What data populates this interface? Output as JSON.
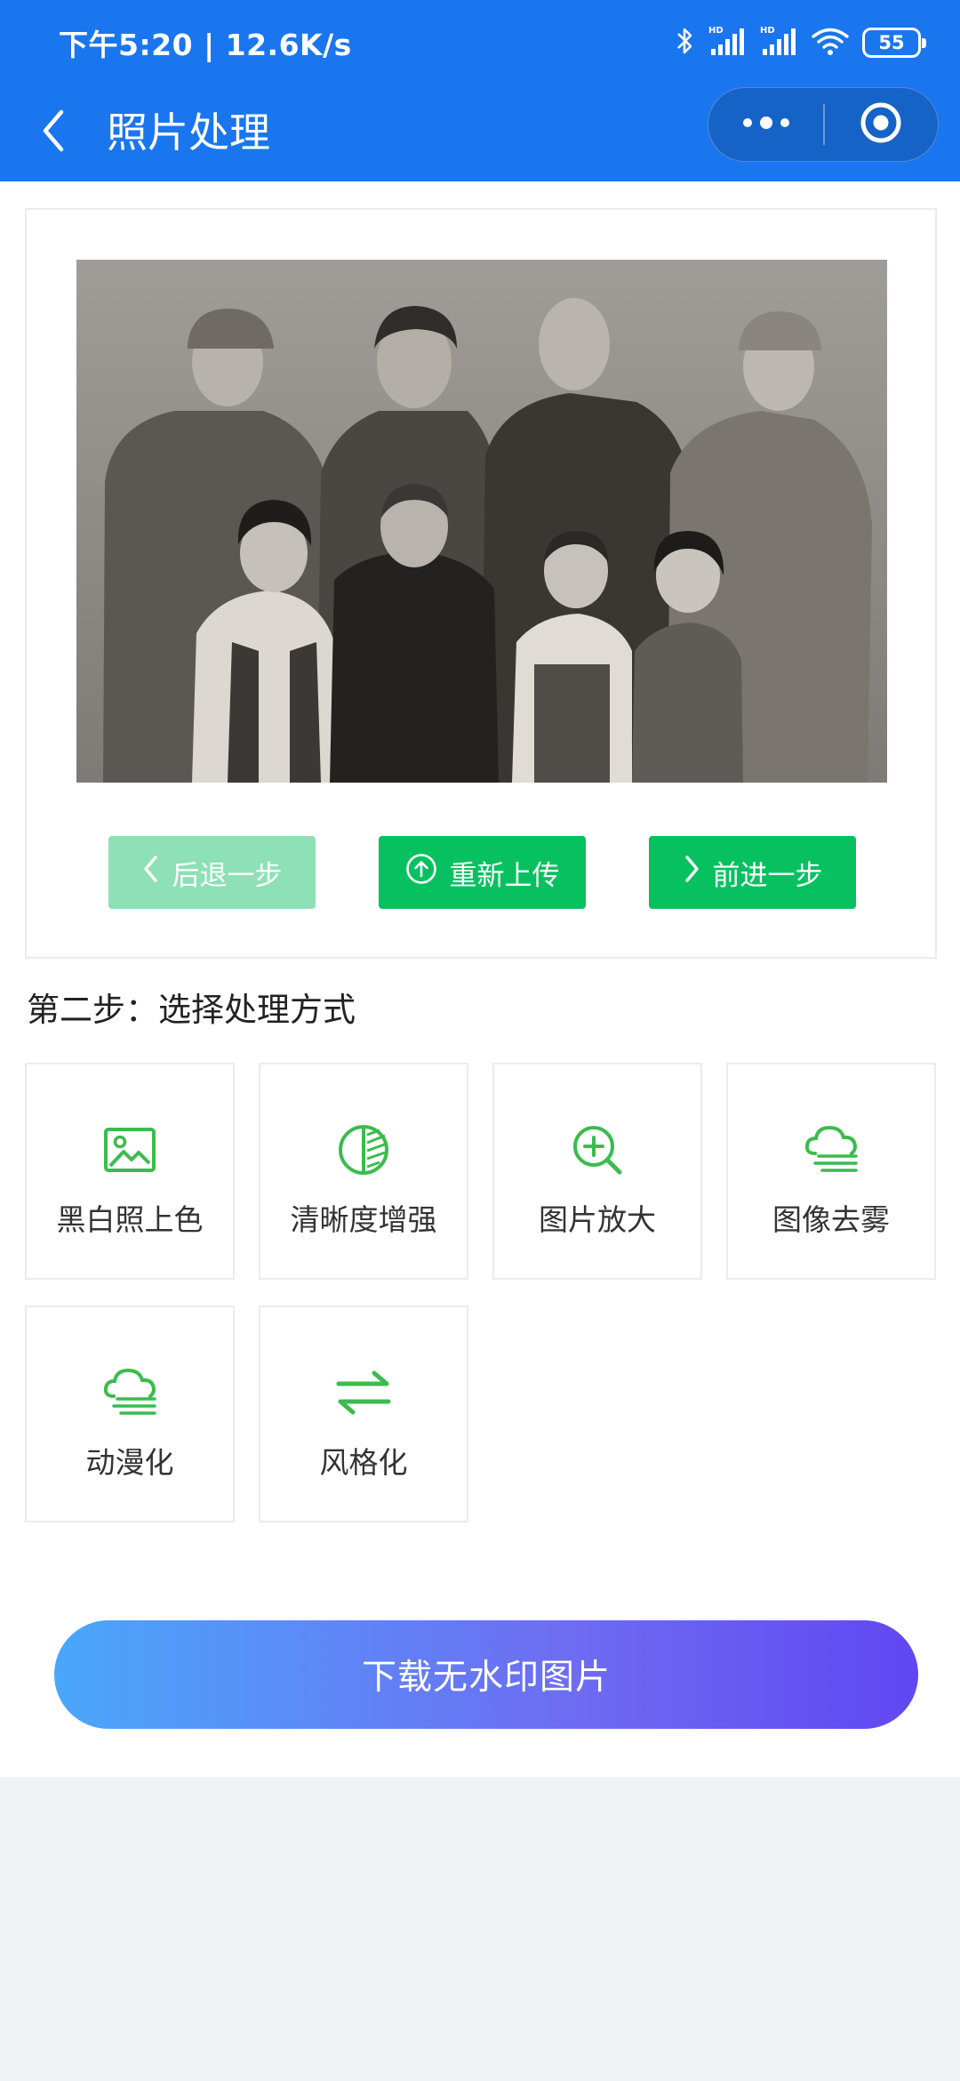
{
  "status_bar": {
    "time_speed": "下午5:20 | 12.6K/s",
    "battery": "55",
    "icons": [
      "bluetooth-icon",
      "signal-hd-icon",
      "signal-hd-icon",
      "wifi-icon",
      "battery-icon"
    ]
  },
  "nav": {
    "title": "照片处理",
    "back_icon": "back-chevron-icon",
    "more_icon": "more-dots-icon",
    "close_icon": "target-circle-icon"
  },
  "photo_controls": {
    "undo_label": "后退一步",
    "reupload_label": "重新上传",
    "redo_label": "前进一步",
    "undo_enabled": false
  },
  "step_two": {
    "title": "第二步：选择处理方式",
    "options": [
      {
        "label": "黑白照上色",
        "icon": "image-icon"
      },
      {
        "label": "清晰度增强",
        "icon": "contrast-half-icon"
      },
      {
        "label": "图片放大",
        "icon": "zoom-in-icon"
      },
      {
        "label": "图像去雾",
        "icon": "cloud-fog-icon"
      },
      {
        "label": "动漫化",
        "icon": "cloud-fog-icon"
      },
      {
        "label": "风格化",
        "icon": "swap-arrows-icon"
      }
    ]
  },
  "download_label": "下载无水印图片",
  "colors": {
    "primary_blue": "#1a76ee",
    "action_green": "#07c160",
    "disabled_green": "#8ee0b6",
    "icon_green": "#3cbb4e",
    "gradient_start": "#4aa7fb",
    "gradient_end": "#6047f2"
  }
}
